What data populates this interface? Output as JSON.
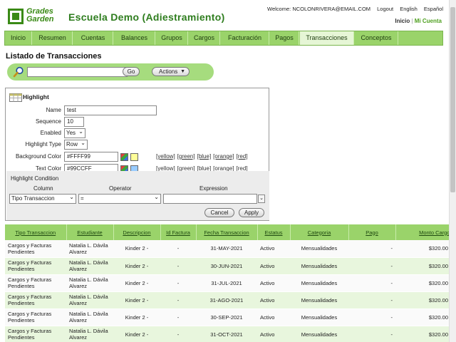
{
  "brand": {
    "logo_line1": "Grades",
    "logo_line2": "Garden",
    "org_title": "Escuela Demo (Adiestramiento)"
  },
  "topbar": {
    "welcome": "Welcome: NCOLONRIVERA@EMAIL.COM",
    "logout": "Logout",
    "english": "English",
    "espanol": "Español",
    "inicio": "Inicio",
    "sep": " | ",
    "mi_cuenta": "Mi Cuenta"
  },
  "nav": [
    "Inicio",
    "Resumen",
    "Cuentas",
    "Balances",
    "Grupos",
    "Cargos",
    "Facturación",
    "Pagos",
    "Transacciones",
    "Conceptos"
  ],
  "nav_active": "Transacciones",
  "page_title": "Listado de Transacciones",
  "search": {
    "value": "",
    "go_label": "Go",
    "actions_label": "Actions"
  },
  "highlight": {
    "title": "Highlight",
    "name_label": "Name",
    "name_value": "test",
    "sequence_label": "Sequence",
    "sequence_value": "10",
    "enabled_label": "Enabled",
    "enabled_value": "Yes",
    "type_label": "Highlight Type",
    "type_value": "Row",
    "bg_label": "Background Color",
    "bg_value": "#FFFF99",
    "bg_swatch": "#FFFF99",
    "text_label": "Text Color",
    "text_value": "#99CCFF",
    "text_swatch": "#99CCFF",
    "color_links": [
      "[yellow]",
      "[green]",
      "[blue]",
      "[orange]",
      "[red]"
    ],
    "condition_label": "Highlight Condition",
    "column_hdr": "Column",
    "operator_hdr": "Operator",
    "expression_hdr": "Expression",
    "column_value": "Tipo Transaccion",
    "operator_value": "=",
    "expression_value": "",
    "cancel_label": "Cancel",
    "apply_label": "Apply"
  },
  "table": {
    "headers": [
      "Tipo Transaccion",
      "Estudiante",
      "Descripcion",
      "Id Factura",
      "Fecha Transaccion",
      "Estatus",
      "Categoria",
      "Pago",
      "Monto Cargo"
    ],
    "rows": [
      [
        "Cargos y Facturas Pendientes",
        "Natalia L. Dávila Alvarez",
        "Kinder 2 -",
        "-",
        "31-MAY-2021",
        "Activo",
        "Mensualidades",
        "-",
        "$320.00"
      ],
      [
        "Cargos y Facturas Pendientes",
        "Natalia L. Dávila Alvarez",
        "Kinder 2 -",
        "-",
        "30-JUN-2021",
        "Activo",
        "Mensualidades",
        "-",
        "$320.00"
      ],
      [
        "Cargos y Facturas Pendientes",
        "Natalia L. Dávila Alvarez",
        "Kinder 2 -",
        "-",
        "31-JUL-2021",
        "Activo",
        "Mensualidades",
        "-",
        "$320.00"
      ],
      [
        "Cargos y Facturas Pendientes",
        "Natalia L. Dávila Alvarez",
        "Kinder 2 -",
        "-",
        "31-AGO-2021",
        "Activo",
        "Mensualidades",
        "-",
        "$320.00"
      ],
      [
        "Cargos y Facturas Pendientes",
        "Natalia L. Dávila Alvarez",
        "Kinder 2 -",
        "-",
        "30-SEP-2021",
        "Activo",
        "Mensualidades",
        "-",
        "$320.00"
      ],
      [
        "Cargos y Facturas Pendientes",
        "Natalia L. Dávila Alvarez",
        "Kinder 2 -",
        "-",
        "31-OCT-2021",
        "Activo",
        "Mensualidades",
        "-",
        "$320.00"
      ]
    ]
  },
  "icons": {
    "logo": "grades-garden-logo",
    "search": "magnifier-icon",
    "highlight": "table-highlight-icon",
    "palette": "color-palette-icon"
  }
}
